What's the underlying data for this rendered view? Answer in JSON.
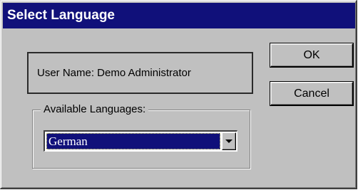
{
  "window": {
    "title": "Select Language"
  },
  "user": {
    "label": "User Name: Demo Administrator"
  },
  "languages": {
    "group_label": "Available Languages:",
    "selected": "German",
    "dropdown_icon": "chevron-down-icon"
  },
  "buttons": {
    "ok_label": "OK",
    "cancel_label": "Cancel"
  },
  "colors": {
    "titlebar": "#10107a",
    "dialog_face": "#c0c0c0",
    "selection": "#10107a"
  }
}
